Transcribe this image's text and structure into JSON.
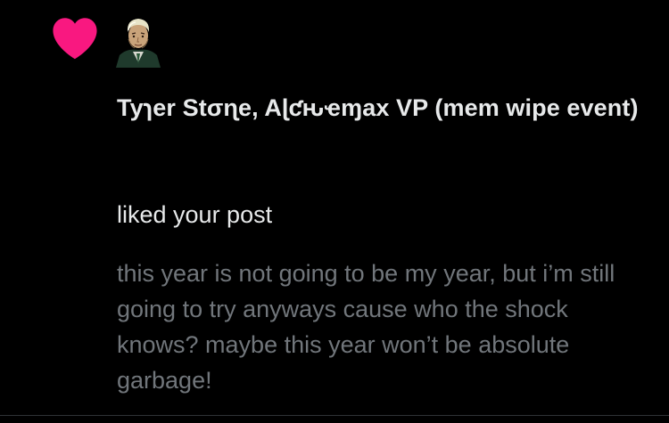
{
  "notification": {
    "type_icon": "heart-icon",
    "avatar_icon": "user-avatar",
    "author_name": "Tyɿer Stσɳe, Aɭƈԋҽɱax VP (mem wipe event)",
    "action": "liked your post",
    "post_text": "this year is not going to be my year, but i’m still going to try anyways cause who the shock knows? maybe this year won’t be absolute garbage!"
  },
  "colors": {
    "background": "#000000",
    "heart": "#f91880",
    "primary_text": "#e7e9ea",
    "secondary_text": "#71767b",
    "divider": "#2f3336"
  }
}
